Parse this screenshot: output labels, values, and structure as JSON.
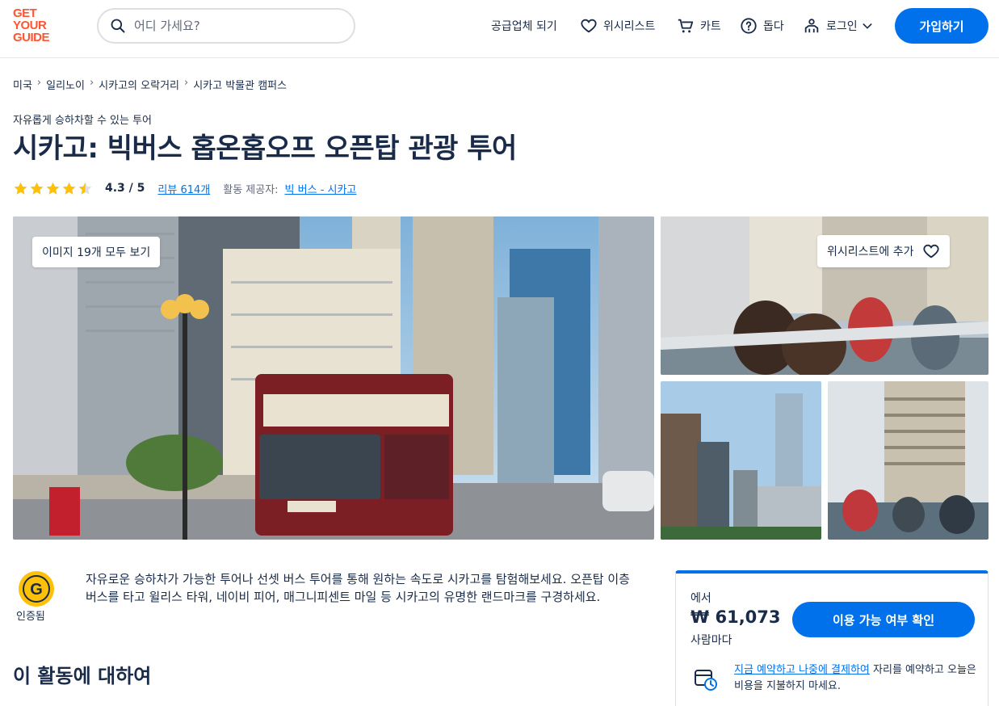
{
  "header": {
    "logo_lines": [
      "GET",
      "YOUR",
      "GUIDE"
    ],
    "search_placeholder": "어디 가세요?",
    "become_supplier": "공급업체 되기",
    "wishlist": "위시리스트",
    "cart": "카트",
    "help": "돕다",
    "login": "로그인",
    "signup": "가입하기"
  },
  "breadcrumb": [
    "미국",
    "일리노이",
    "시카고의 오락거리",
    "시카고 박물관 캠퍼스"
  ],
  "subtitle": "자유롭게 승하차할 수 있는 투어",
  "title": "시카고: 빅버스 홉온홉오프 오픈탑 관광 투어",
  "rating": {
    "stars": 4.3,
    "score": "4.3 / 5",
    "reviews": "리뷰 614개",
    "provider_label": "활동 제공자:",
    "provider": "빅 버스 - 시카고"
  },
  "gallery": {
    "view_all": "이미지 19개 모두 보기",
    "add_wishlist": "위시리스트에 추가"
  },
  "certified": "인증됨",
  "description": "자유로운 승하차가 가능한 투어나 선셋 버스 투어를 통해 원하는 속도로 시카고를 탐험해보세요. 오픈탑 이층 버스를 타고 윌리스 타워, 네이비 피어, 매그니피센트 마일 등 시카고의 유명한 랜드마크를 구경하세요.",
  "about_heading": "이 활동에 대하여",
  "booking": {
    "from": "에서",
    "price": "₩ 61,073",
    "per": "사람마다",
    "check": "이용 가능 여부 확인",
    "reserve_link": "지금 예약하고 나중에 결제하여",
    "reserve_text": " 자리를 예약하고 오늘은 비용을 지불하지 마세요."
  },
  "colors": {
    "accent": "#0071eb",
    "brand": "#ff5533",
    "text": "#1a2b49",
    "star": "#ffc107"
  }
}
